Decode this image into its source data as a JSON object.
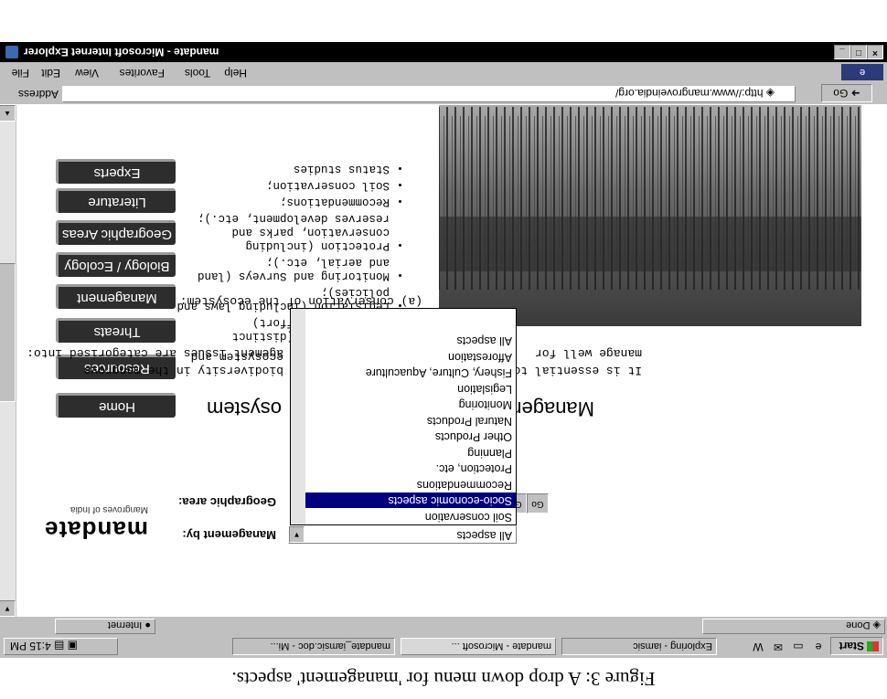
{
  "caption": "Figure 3: A drop down menu for 'management' aspects.",
  "window": {
    "title": "mandate - Microsoft Internet Explorer",
    "controls": {
      "minimize": "_",
      "maximize": "□",
      "close": "×"
    }
  },
  "menu": {
    "items": [
      "File",
      "Edit",
      "View",
      "Favorites",
      "Tools",
      "Help"
    ]
  },
  "address": {
    "label": "Address",
    "url": "http://www.mangroveindia.org/",
    "go": "Go"
  },
  "site": {
    "title": "mandate",
    "subtitle": "Mangroves of India",
    "nav": [
      "Home",
      "Resources",
      "Threats",
      "Management",
      "Biology / Ecology",
      "Geographic Areas",
      "Literature",
      "Experts"
    ]
  },
  "controls": {
    "management_label": "Management by:",
    "management_value": "All aspects",
    "geographic_label": "Geographic area:",
    "go": "Go",
    "dropdown_options": [
      "All aspects",
      "Afforestation",
      "Fishery, Culture, Aquaculture",
      "Legislation",
      "Monitoring",
      "Natural Products",
      "Other Products",
      "Planning",
      "Protection, etc.",
      "Recommendations",
      "Socio-economic aspects",
      "Soil conservation"
    ],
    "dropdown_selected": "Socio-economic aspects"
  },
  "main": {
    "heading_left": "Managemen",
    "heading_right": "osystem",
    "intro_left_1": "It is essential to",
    "intro_left_2": "manage well for",
    "intro_right_1": "biodiversity in the mangrove ecosystem and",
    "intro_right_2": "agement issues are categorised into:",
    "list_intro": "(a) conservation of the ecosystem:",
    "bullets": [
      "Afforestation (distinct conservation effort)",
      "Legislation (including laws and policies);",
      "Monitoring and Surveys (land and aerial, etc.);",
      "Protection (including conservation, parks and reserves development, etc.);",
      "Recommendations;",
      "Soil conservation;",
      "Status studies"
    ]
  },
  "status": {
    "left": "Done",
    "zone": "Internet"
  },
  "taskbar": {
    "start": "Start",
    "tasks": [
      "Exploring - iamsic",
      "mandate - Microsoft ...",
      "mandate_iamsic.doc - Mi..."
    ],
    "clock": "4:15 PM"
  }
}
